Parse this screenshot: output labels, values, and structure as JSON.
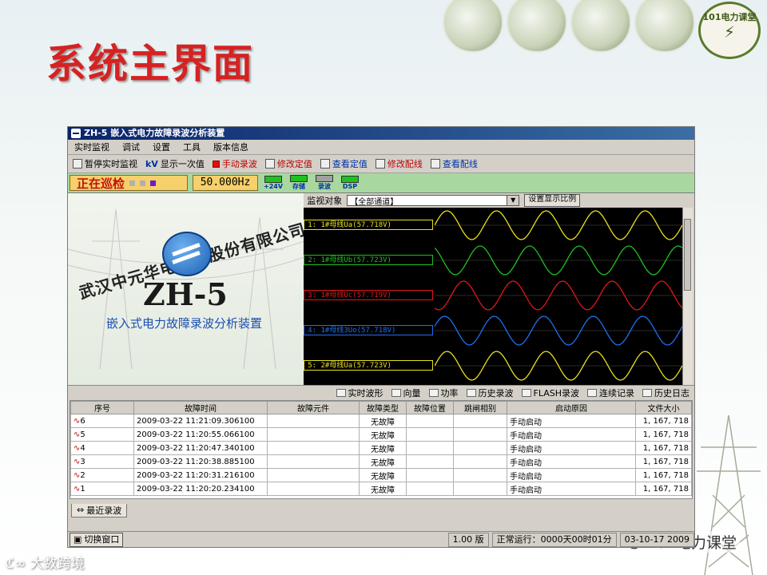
{
  "slide": {
    "title": "系统主界面",
    "logo_text": "101电力课堂",
    "footer_left": "大数跨境",
    "footer_right": "101电力课堂"
  },
  "window": {
    "title": "ZH-5 嵌入式电力故障录波分析装置"
  },
  "menu": [
    "实时监视",
    "调试",
    "设置",
    "工具",
    "版本信息"
  ],
  "toolbar": {
    "pause": "暂停实时监视",
    "kv_prefix": "kV",
    "show_once": "显示一次值",
    "manual_record": "手动录波",
    "edit_setting": "修改定值",
    "view_setting": "查看定值",
    "edit_wiring": "修改配线",
    "view_wiring": "查看配线"
  },
  "status": {
    "patrol": "正在巡检",
    "frequency": "50.000Hz",
    "leds": [
      {
        "label": "+24V",
        "color": "#20c020"
      },
      {
        "label": "存储",
        "color": "#20c020"
      },
      {
        "label": "录波",
        "color": "#a0a0a0"
      },
      {
        "label": "DSP",
        "color": "#20c020"
      }
    ]
  },
  "splash": {
    "company": "武汉中元华电科技股份有限公司",
    "model": "ZH-5",
    "subtitle": "嵌入式电力故障录波分析装置"
  },
  "scope": {
    "monitor_label": "监视对象",
    "select_value": "【全部通道】",
    "scale_button": "设置显示比例",
    "channels": [
      {
        "label": "1: 1#母线Ua(57.718V)",
        "color": "#e8e020"
      },
      {
        "label": "2: 1#母线Ub(57.723V)",
        "color": "#20c020"
      },
      {
        "label": "3: 1#母线Uc(57.719V)",
        "color": "#e01818"
      },
      {
        "label": "4: 1#母线3Uo(57.718V)",
        "color": "#2070f0"
      },
      {
        "label": "5: 2#母线Ua(57.723V)",
        "color": "#e8e020"
      }
    ]
  },
  "tabs": [
    "实时波形",
    "向量",
    "功率",
    "历史录波",
    "FLASH录波",
    "连续记录",
    "历史日志"
  ],
  "table": {
    "headers": [
      "序号",
      "故障时间",
      "故障元件",
      "故障类型",
      "故障位置",
      "跳闸相别",
      "启动原因",
      "文件大小"
    ],
    "rows": [
      {
        "no": "6",
        "time": "2009-03-22 11:21:09.306100",
        "elem": "",
        "type": "无故障",
        "pos": "",
        "phase": "",
        "reason": "手动启动",
        "size": "1, 167, 718"
      },
      {
        "no": "5",
        "time": "2009-03-22 11:20:55.066100",
        "elem": "",
        "type": "无故障",
        "pos": "",
        "phase": "",
        "reason": "手动启动",
        "size": "1, 167, 718"
      },
      {
        "no": "4",
        "time": "2009-03-22 11:20:47.340100",
        "elem": "",
        "type": "无故障",
        "pos": "",
        "phase": "",
        "reason": "手动启动",
        "size": "1, 167, 718"
      },
      {
        "no": "3",
        "time": "2009-03-22 11:20:38.885100",
        "elem": "",
        "type": "无故障",
        "pos": "",
        "phase": "",
        "reason": "手动启动",
        "size": "1, 167, 718"
      },
      {
        "no": "2",
        "time": "2009-03-22 11:20:31.216100",
        "elem": "",
        "type": "无故障",
        "pos": "",
        "phase": "",
        "reason": "手动启动",
        "size": "1, 167, 718"
      },
      {
        "no": "1",
        "time": "2009-03-22 11:20:20.234100",
        "elem": "",
        "type": "无故障",
        "pos": "",
        "phase": "",
        "reason": "手动启动",
        "size": "1, 167, 718"
      }
    ]
  },
  "bottom_tab": "最近录波",
  "statusbar": {
    "switch": "切换窗口",
    "version": "1.00 版",
    "runtime": "正常运行：0000天00时01分",
    "date": "03-10-17 2009"
  }
}
